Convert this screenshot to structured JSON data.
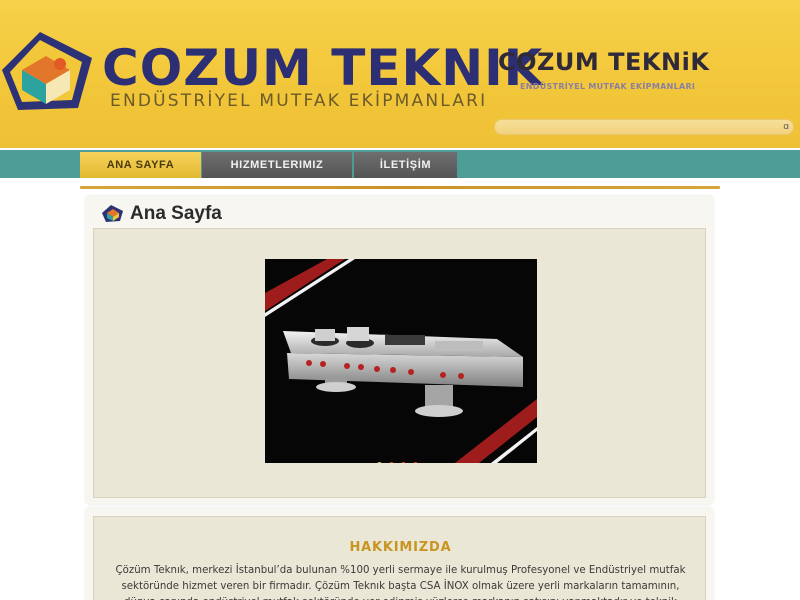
{
  "header": {
    "brand_name": "COZUM TEKNIK",
    "brand_tagline": "ENDÜSTRİYEL MUTFAK EKİPMANLARI",
    "brand_name_small": "COZUM TEKNiK",
    "brand_tagline_small": "ENDÜSTRİYEL MUTFAK EKİPMANLARI",
    "search": {
      "value": "",
      "placeholder": "",
      "icon_glyph": "ɑ"
    }
  },
  "nav": {
    "items": [
      {
        "label": "ANA SAYFA",
        "active": true
      },
      {
        "label": "HIZMETLERIMIZ",
        "active": false
      },
      {
        "label": "İLETİŞİM",
        "active": false
      }
    ]
  },
  "main": {
    "page_title": "Ana Sayfa",
    "slider": {
      "dots": 4,
      "active_index": 0
    }
  },
  "about": {
    "heading": "HAKKIMIZDA",
    "text": "Çözüm Teknık, merkezi İstanbul’da bulunan %100 yerli sermaye ile kurulmuş Profesyonel ve Endüstriyel mutfak sektöründe hizmet veren bir firmadır. Çözüm Teknık başta CSA İNOX olmak üzere yerli markaların tamamının, dünya çapında endüstriyel mutfak sektöründe yer edinmiş yüzlerce markanın satışını yapmaktadır ve teknik servisi"
  },
  "colors": {
    "header_bg": "#f3c73a",
    "nav_bg": "#4e9c96",
    "nav_active_bg": "#e9c03e",
    "nav_inactive_bg": "#5e5e5e",
    "brand_navy": "#2c2f73",
    "accent_gold": "#c89520",
    "panel_bg": "#ebe7d6"
  },
  "icons": {
    "logo": "cube-logo-icon",
    "title": "cube-logo-small-icon",
    "search": "search-icon"
  }
}
